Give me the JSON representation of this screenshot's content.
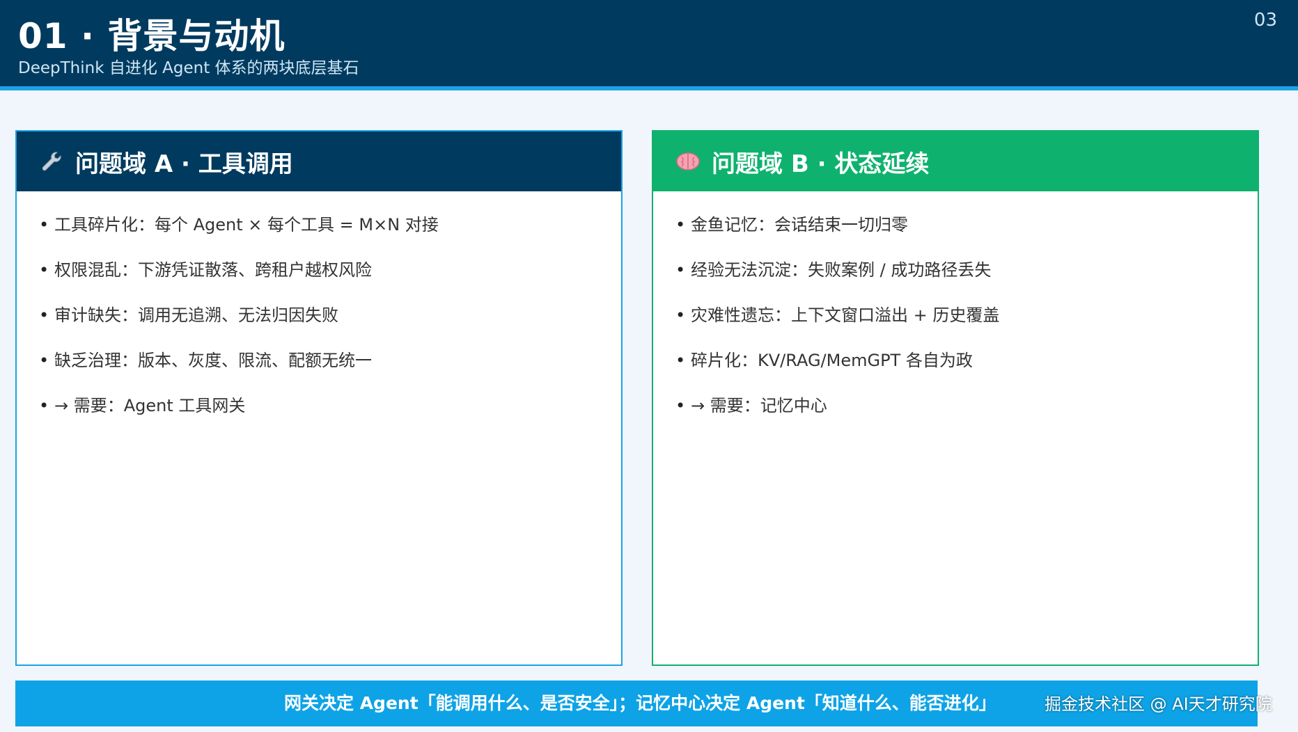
{
  "header": {
    "title": "01 · 背景与动机",
    "subtitle": "DeepThink 自进化 Agent 体系的两块底层基石",
    "page_number": "03"
  },
  "card_a": {
    "icon": "wrench-icon",
    "title": "问题域 A · 工具调用",
    "items": [
      "工具碎片化：每个 Agent × 每个工具 = M×N 对接",
      "权限混乱：下游凭证散落、跨租户越权风险",
      "审计缺失：调用无追溯、无法归因失败",
      "缺乏治理：版本、灰度、限流、配额无统一",
      "→ 需要：Agent 工具网关"
    ]
  },
  "card_b": {
    "icon": "brain-icon",
    "title": "问题域 B · 状态延续",
    "items": [
      "金鱼记忆：会话结束一切归零",
      "经验无法沉淀：失败案例 / 成功路径丢失",
      "灾难性遗忘：上下文窗口溢出 + 历史覆盖",
      "碎片化：KV/RAG/MemGPT 各自为政",
      "→ 需要：记忆中心"
    ]
  },
  "footer": {
    "text": "网关决定 Agent「能调用什么、是否安全」；记忆中心决定 Agent「知道什么、能否进化」"
  },
  "watermark": "掘金技术社区 @ AI天才研究院",
  "colors": {
    "header_bg": "#003b5f",
    "accent_blue": "#1ba3e6",
    "accent_green": "#0eb26e",
    "page_bg": "#f0f6fc"
  }
}
